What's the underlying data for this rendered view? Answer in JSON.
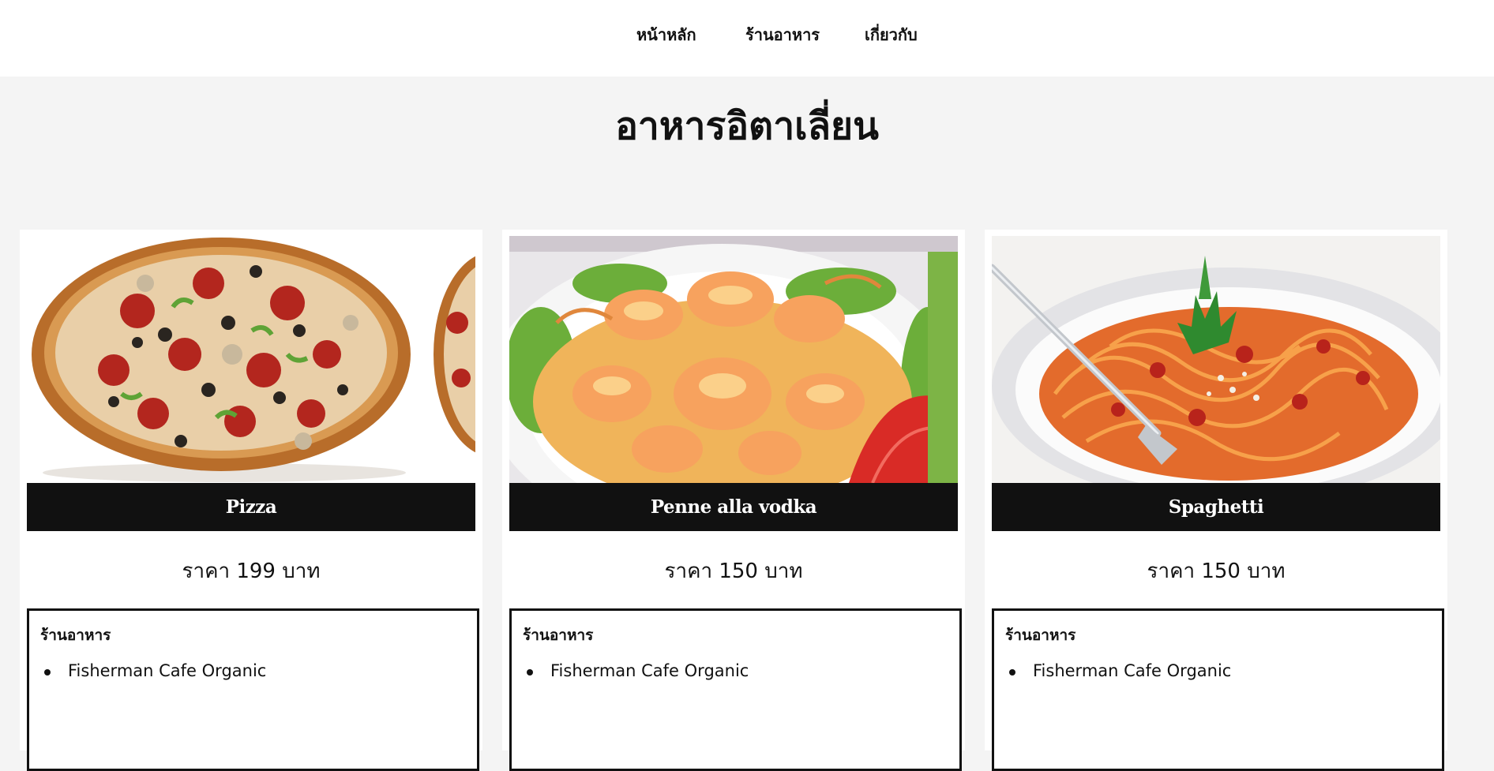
{
  "nav": {
    "items": [
      {
        "label": "หน้าหลัก"
      },
      {
        "label": "ร้านอาหาร"
      },
      {
        "label": "เกี่ยวกับ"
      }
    ]
  },
  "page": {
    "title": "อาหารอิตาเลี่ยน"
  },
  "cards": [
    {
      "name": "Pizza",
      "price": "ราคา 199 บาท",
      "restaurants_heading": "ร้านอาหาร",
      "restaurants": [
        "Fisherman Cafe Organic"
      ]
    },
    {
      "name": "Penne alla vodka",
      "price": "ราคา 150 บาท",
      "restaurants_heading": "ร้านอาหาร",
      "restaurants": [
        "Fisherman Cafe Organic"
      ]
    },
    {
      "name": "Spaghetti",
      "price": "ราคา 150 บาท",
      "restaurants_heading": "ร้านอาหาร",
      "restaurants": [
        "Fisherman Cafe Organic"
      ]
    }
  ],
  "colors": {
    "background": "#f4f4f4",
    "card": "#ffffff",
    "name_bar": "#111111",
    "text": "#111111"
  }
}
